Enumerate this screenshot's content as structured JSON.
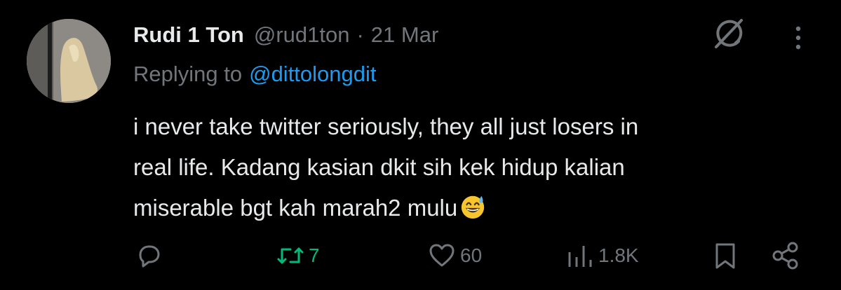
{
  "tweet": {
    "display_name": "Rudi 1 Ton",
    "handle": "@rud1ton",
    "separator": "·",
    "date": "21 Mar",
    "replying_prefix": "Replying to",
    "replying_to": "@dittolongdit",
    "lines": [
      "i never take twitter seriously, they all just losers in",
      "real life. Kadang kasian dkit sih kek hidup kalian",
      "miserable bgt kah marah2 mulu"
    ],
    "emoji": "grinning-face-with-sweat"
  },
  "actions": {
    "reply_count": "",
    "retweet_count": "7",
    "like_count": "60",
    "views_count": "1.8K"
  },
  "colors": {
    "background": "#000000",
    "text": "#e7e9ea",
    "muted": "#71767b",
    "link": "#1d9bf0",
    "retweeted": "#00ba7c"
  }
}
